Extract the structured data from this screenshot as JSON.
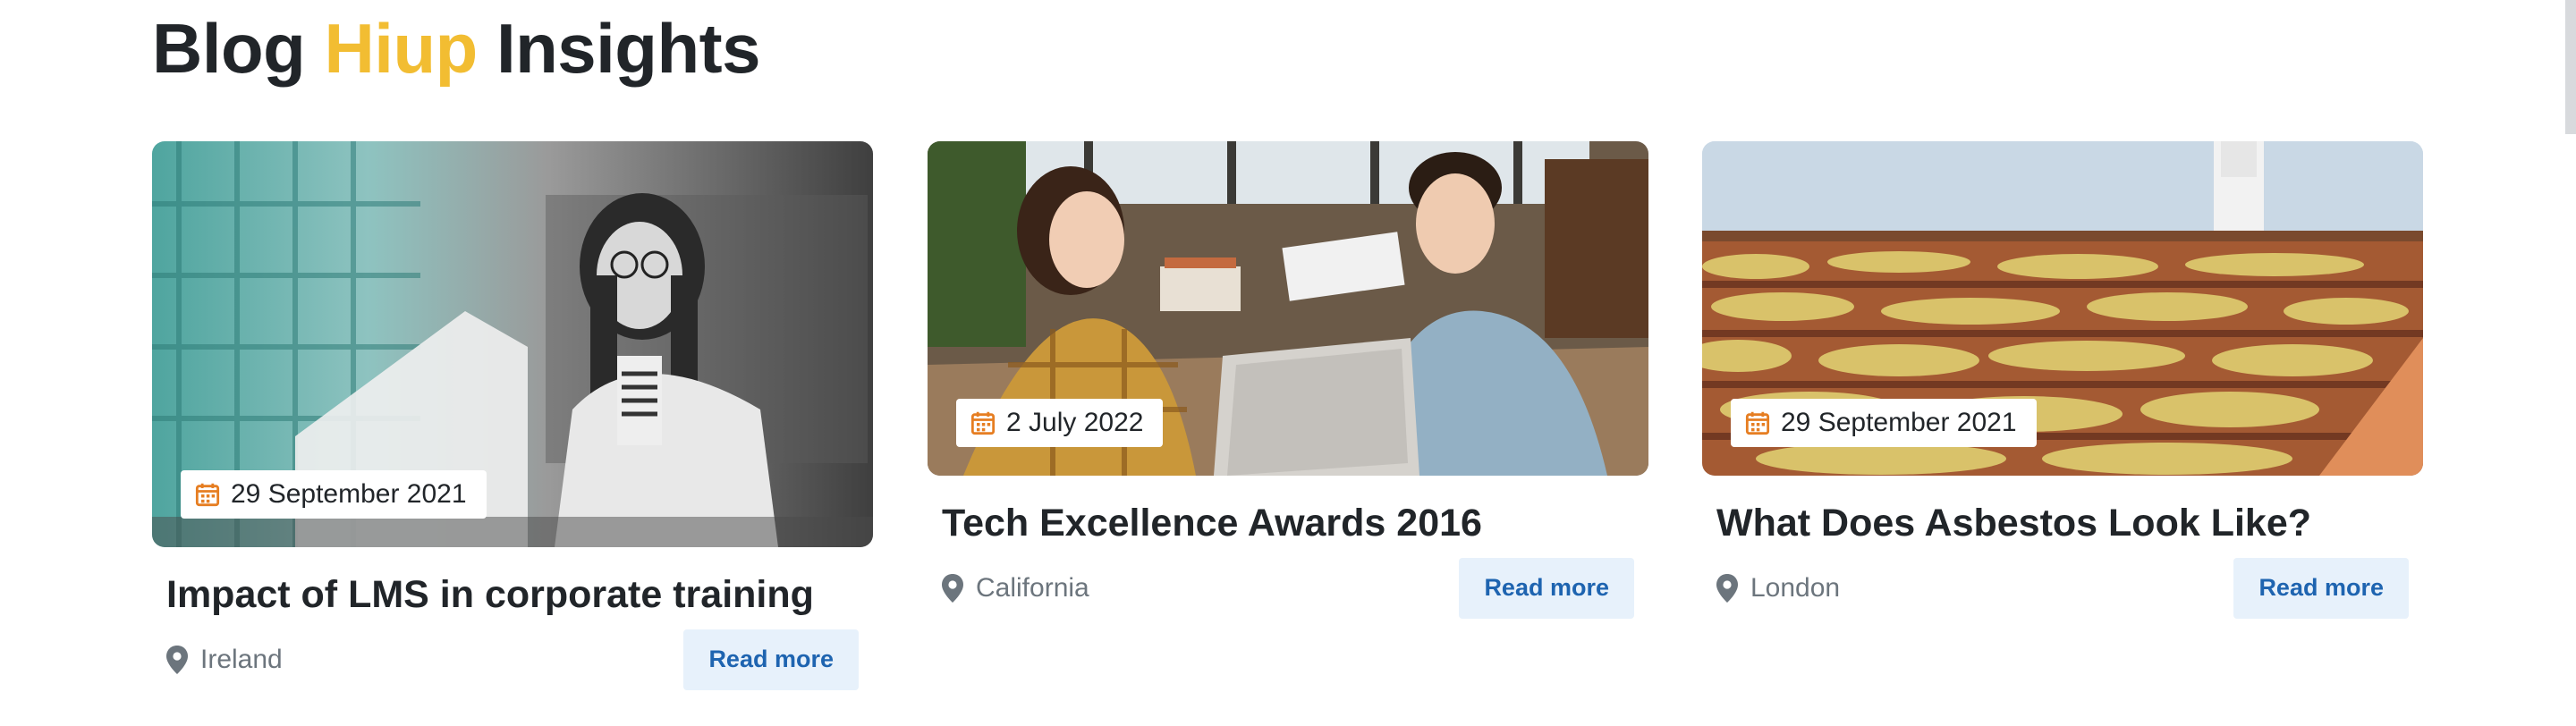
{
  "header": {
    "title_part1": "Blog",
    "title_accent": "Hiup",
    "title_part2": "Insights",
    "accent_color": "#f2bd32"
  },
  "cards": [
    {
      "date": "29 September 2021",
      "title": "Impact of LMS in corporate training",
      "location": "Ireland",
      "button_label": "Read more"
    },
    {
      "date": "2 July 2022",
      "title": "Tech Excellence Awards 2016",
      "location": "California",
      "button_label": "Read more"
    },
    {
      "date": "29 September 2021",
      "title": "What Does Asbestos Look Like?",
      "location": "London",
      "button_label": "Read more"
    }
  ],
  "icons": {
    "date": "calendar-icon",
    "location": "map-pin-icon"
  },
  "colors": {
    "calendar_icon": "#e67e22",
    "button_bg": "#e7f1fb",
    "button_text": "#1e64b0",
    "location_text": "#6c757d"
  }
}
